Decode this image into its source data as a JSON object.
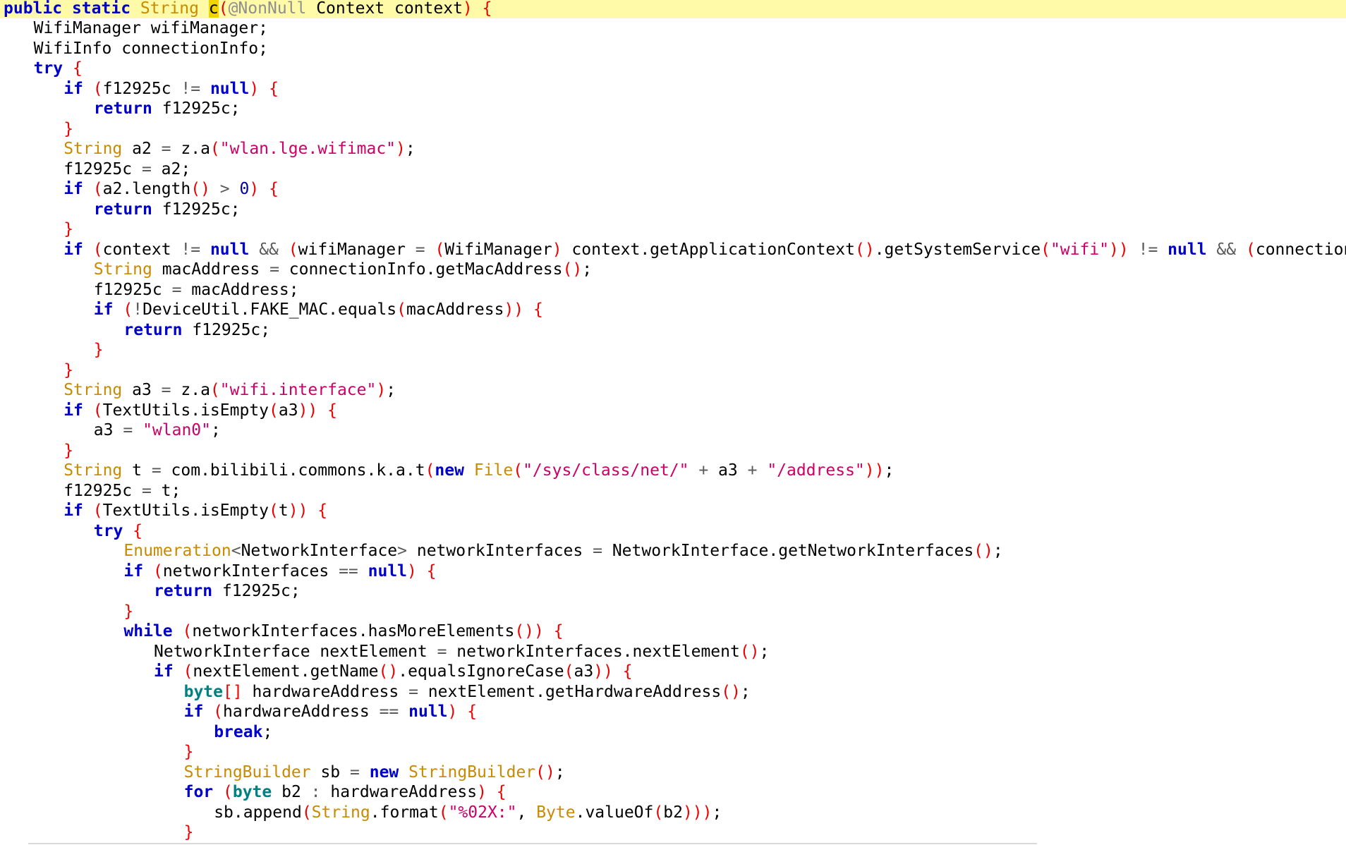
{
  "editor": {
    "language": "Java",
    "current_line": 0,
    "colors": {
      "keyword": "#0000cc",
      "type": "#c88a00",
      "primitive": "#008080",
      "string": "#cc0066",
      "number": "#0000aa",
      "bracket": "#ee0000",
      "annotation": "#8f8f8f",
      "operator": "#5a5a5a",
      "plain": "#000000",
      "current_line_bg": "#fffaa8",
      "symbol_highlight_bg": "#f0d400"
    },
    "lines": [
      {
        "indent": 0,
        "tokens": [
          [
            "kw",
            "public"
          ],
          [
            "pl",
            " "
          ],
          [
            "kw",
            "static"
          ],
          [
            "pl",
            " "
          ],
          [
            "ty",
            "String"
          ],
          [
            "pl",
            " "
          ],
          [
            "hl",
            "c"
          ],
          [
            "br",
            "("
          ],
          [
            "ann",
            "@NonNull"
          ],
          [
            "pl",
            " Context context"
          ],
          [
            "br",
            ")"
          ],
          [
            "pl",
            " "
          ],
          [
            "br",
            "{"
          ]
        ]
      },
      {
        "indent": 1,
        "tokens": [
          [
            "pl",
            "WifiManager wifiManager;"
          ]
        ]
      },
      {
        "indent": 1,
        "tokens": [
          [
            "pl",
            "WifiInfo connectionInfo;"
          ]
        ]
      },
      {
        "indent": 1,
        "tokens": [
          [
            "kw",
            "try"
          ],
          [
            "pl",
            " "
          ],
          [
            "br",
            "{"
          ]
        ]
      },
      {
        "indent": 2,
        "tokens": [
          [
            "kw",
            "if"
          ],
          [
            "pl",
            " "
          ],
          [
            "br",
            "("
          ],
          [
            "pl",
            "f12925c "
          ],
          [
            "op",
            "!="
          ],
          [
            "pl",
            " "
          ],
          [
            "kw",
            "null"
          ],
          [
            "br",
            ")"
          ],
          [
            "pl",
            " "
          ],
          [
            "br",
            "{"
          ]
        ]
      },
      {
        "indent": 3,
        "tokens": [
          [
            "kw",
            "return"
          ],
          [
            "pl",
            " f12925c;"
          ]
        ]
      },
      {
        "indent": 2,
        "tokens": [
          [
            "br",
            "}"
          ]
        ]
      },
      {
        "indent": 2,
        "tokens": [
          [
            "ty",
            "String"
          ],
          [
            "pl",
            " a2 "
          ],
          [
            "op",
            "="
          ],
          [
            "pl",
            " z.a"
          ],
          [
            "br",
            "("
          ],
          [
            "str",
            "\"wlan.lge.wifimac\""
          ],
          [
            "br",
            ")"
          ],
          [
            "pl",
            ";"
          ]
        ]
      },
      {
        "indent": 2,
        "tokens": [
          [
            "pl",
            "f12925c "
          ],
          [
            "op",
            "="
          ],
          [
            "pl",
            " a2;"
          ]
        ]
      },
      {
        "indent": 2,
        "tokens": [
          [
            "kw",
            "if"
          ],
          [
            "pl",
            " "
          ],
          [
            "br",
            "("
          ],
          [
            "pl",
            "a2.length"
          ],
          [
            "br",
            "()"
          ],
          [
            "pl",
            " "
          ],
          [
            "op",
            ">"
          ],
          [
            "pl",
            " "
          ],
          [
            "num",
            "0"
          ],
          [
            "br",
            ")"
          ],
          [
            "pl",
            " "
          ],
          [
            "br",
            "{"
          ]
        ]
      },
      {
        "indent": 3,
        "tokens": [
          [
            "kw",
            "return"
          ],
          [
            "pl",
            " f12925c;"
          ]
        ]
      },
      {
        "indent": 2,
        "tokens": [
          [
            "br",
            "}"
          ]
        ]
      },
      {
        "indent": 2,
        "tokens": [
          [
            "kw",
            "if"
          ],
          [
            "pl",
            " "
          ],
          [
            "br",
            "("
          ],
          [
            "pl",
            "context "
          ],
          [
            "op",
            "!="
          ],
          [
            "pl",
            " "
          ],
          [
            "kw",
            "null"
          ],
          [
            "pl",
            " "
          ],
          [
            "op",
            "&&"
          ],
          [
            "pl",
            " "
          ],
          [
            "br",
            "("
          ],
          [
            "pl",
            "wifiManager "
          ],
          [
            "op",
            "="
          ],
          [
            "pl",
            " "
          ],
          [
            "br",
            "("
          ],
          [
            "pl",
            "WifiManager"
          ],
          [
            "br",
            ")"
          ],
          [
            "pl",
            " context.getApplicationContext"
          ],
          [
            "br",
            "()"
          ],
          [
            "pl",
            ".getSystemService"
          ],
          [
            "br",
            "("
          ],
          [
            "str",
            "\"wifi\""
          ],
          [
            "br",
            "))"
          ],
          [
            "pl",
            " "
          ],
          [
            "op",
            "!="
          ],
          [
            "pl",
            " "
          ],
          [
            "kw",
            "null"
          ],
          [
            "pl",
            " "
          ],
          [
            "op",
            "&&"
          ],
          [
            "pl",
            " "
          ],
          [
            "br",
            "("
          ],
          [
            "pl",
            "connectionInfo "
          ],
          [
            "op",
            "="
          ]
        ]
      },
      {
        "indent": 3,
        "tokens": [
          [
            "ty",
            "String"
          ],
          [
            "pl",
            " macAddress "
          ],
          [
            "op",
            "="
          ],
          [
            "pl",
            " connectionInfo.getMacAddress"
          ],
          [
            "br",
            "()"
          ],
          [
            "pl",
            ";"
          ]
        ]
      },
      {
        "indent": 3,
        "tokens": [
          [
            "pl",
            "f12925c "
          ],
          [
            "op",
            "="
          ],
          [
            "pl",
            " macAddress;"
          ]
        ]
      },
      {
        "indent": 3,
        "tokens": [
          [
            "kw",
            "if"
          ],
          [
            "pl",
            " "
          ],
          [
            "br",
            "("
          ],
          [
            "op",
            "!"
          ],
          [
            "pl",
            "DeviceUtil.FAKE_MAC.equals"
          ],
          [
            "br",
            "("
          ],
          [
            "pl",
            "macAddress"
          ],
          [
            "br",
            "))"
          ],
          [
            "pl",
            " "
          ],
          [
            "br",
            "{"
          ]
        ]
      },
      {
        "indent": 4,
        "tokens": [
          [
            "kw",
            "return"
          ],
          [
            "pl",
            " f12925c;"
          ]
        ]
      },
      {
        "indent": 3,
        "tokens": [
          [
            "br",
            "}"
          ]
        ]
      },
      {
        "indent": 2,
        "tokens": [
          [
            "br",
            "}"
          ]
        ]
      },
      {
        "indent": 2,
        "tokens": [
          [
            "ty",
            "String"
          ],
          [
            "pl",
            " a3 "
          ],
          [
            "op",
            "="
          ],
          [
            "pl",
            " z.a"
          ],
          [
            "br",
            "("
          ],
          [
            "str",
            "\"wifi.interface\""
          ],
          [
            "br",
            ")"
          ],
          [
            "pl",
            ";"
          ]
        ]
      },
      {
        "indent": 2,
        "tokens": [
          [
            "kw",
            "if"
          ],
          [
            "pl",
            " "
          ],
          [
            "br",
            "("
          ],
          [
            "pl",
            "TextUtils.isEmpty"
          ],
          [
            "br",
            "("
          ],
          [
            "pl",
            "a3"
          ],
          [
            "br",
            "))"
          ],
          [
            "pl",
            " "
          ],
          [
            "br",
            "{"
          ]
        ]
      },
      {
        "indent": 3,
        "tokens": [
          [
            "pl",
            "a3 "
          ],
          [
            "op",
            "="
          ],
          [
            "pl",
            " "
          ],
          [
            "str",
            "\"wlan0\""
          ],
          [
            "pl",
            ";"
          ]
        ]
      },
      {
        "indent": 2,
        "tokens": [
          [
            "br",
            "}"
          ]
        ]
      },
      {
        "indent": 2,
        "tokens": [
          [
            "ty",
            "String"
          ],
          [
            "pl",
            " t "
          ],
          [
            "op",
            "="
          ],
          [
            "pl",
            " com.bilibili.commons.k.a.t"
          ],
          [
            "br",
            "("
          ],
          [
            "kw",
            "new"
          ],
          [
            "pl",
            " "
          ],
          [
            "ty",
            "File"
          ],
          [
            "br",
            "("
          ],
          [
            "str",
            "\"/sys/class/net/\""
          ],
          [
            "pl",
            " "
          ],
          [
            "op",
            "+"
          ],
          [
            "pl",
            " a3 "
          ],
          [
            "op",
            "+"
          ],
          [
            "pl",
            " "
          ],
          [
            "str",
            "\"/address\""
          ],
          [
            "br",
            "))"
          ],
          [
            "pl",
            ";"
          ]
        ]
      },
      {
        "indent": 2,
        "tokens": [
          [
            "pl",
            "f12925c "
          ],
          [
            "op",
            "="
          ],
          [
            "pl",
            " t;"
          ]
        ]
      },
      {
        "indent": 2,
        "tokens": [
          [
            "kw",
            "if"
          ],
          [
            "pl",
            " "
          ],
          [
            "br",
            "("
          ],
          [
            "pl",
            "TextUtils.isEmpty"
          ],
          [
            "br",
            "("
          ],
          [
            "pl",
            "t"
          ],
          [
            "br",
            "))"
          ],
          [
            "pl",
            " "
          ],
          [
            "br",
            "{"
          ]
        ]
      },
      {
        "indent": 3,
        "tokens": [
          [
            "kw",
            "try"
          ],
          [
            "pl",
            " "
          ],
          [
            "br",
            "{"
          ]
        ]
      },
      {
        "indent": 4,
        "tokens": [
          [
            "ty",
            "Enumeration"
          ],
          [
            "op",
            "<"
          ],
          [
            "pl",
            "NetworkInterface"
          ],
          [
            "op",
            ">"
          ],
          [
            "pl",
            " networkInterfaces "
          ],
          [
            "op",
            "="
          ],
          [
            "pl",
            " NetworkInterface.getNetworkInterfaces"
          ],
          [
            "br",
            "()"
          ],
          [
            "pl",
            ";"
          ]
        ]
      },
      {
        "indent": 4,
        "tokens": [
          [
            "kw",
            "if"
          ],
          [
            "pl",
            " "
          ],
          [
            "br",
            "("
          ],
          [
            "pl",
            "networkInterfaces "
          ],
          [
            "op",
            "=="
          ],
          [
            "pl",
            " "
          ],
          [
            "kw",
            "null"
          ],
          [
            "br",
            ")"
          ],
          [
            "pl",
            " "
          ],
          [
            "br",
            "{"
          ]
        ]
      },
      {
        "indent": 5,
        "tokens": [
          [
            "kw",
            "return"
          ],
          [
            "pl",
            " f12925c;"
          ]
        ]
      },
      {
        "indent": 4,
        "tokens": [
          [
            "br",
            "}"
          ]
        ]
      },
      {
        "indent": 4,
        "tokens": [
          [
            "kw",
            "while"
          ],
          [
            "pl",
            " "
          ],
          [
            "br",
            "("
          ],
          [
            "pl",
            "networkInterfaces.hasMoreElements"
          ],
          [
            "br",
            "())"
          ],
          [
            "pl",
            " "
          ],
          [
            "br",
            "{"
          ]
        ]
      },
      {
        "indent": 5,
        "tokens": [
          [
            "pl",
            "NetworkInterface nextElement "
          ],
          [
            "op",
            "="
          ],
          [
            "pl",
            " networkInterfaces.nextElement"
          ],
          [
            "br",
            "()"
          ],
          [
            "pl",
            ";"
          ]
        ]
      },
      {
        "indent": 5,
        "tokens": [
          [
            "kw",
            "if"
          ],
          [
            "pl",
            " "
          ],
          [
            "br",
            "("
          ],
          [
            "pl",
            "nextElement.getName"
          ],
          [
            "br",
            "()"
          ],
          [
            "pl",
            ".equalsIgnoreCase"
          ],
          [
            "br",
            "("
          ],
          [
            "pl",
            "a3"
          ],
          [
            "br",
            "))"
          ],
          [
            "pl",
            " "
          ],
          [
            "br",
            "{"
          ]
        ]
      },
      {
        "indent": 6,
        "tokens": [
          [
            "pt",
            "byte"
          ],
          [
            "br",
            "[]"
          ],
          [
            "pl",
            " hardwareAddress "
          ],
          [
            "op",
            "="
          ],
          [
            "pl",
            " nextElement.getHardwareAddress"
          ],
          [
            "br",
            "()"
          ],
          [
            "pl",
            ";"
          ]
        ]
      },
      {
        "indent": 6,
        "tokens": [
          [
            "kw",
            "if"
          ],
          [
            "pl",
            " "
          ],
          [
            "br",
            "("
          ],
          [
            "pl",
            "hardwareAddress "
          ],
          [
            "op",
            "=="
          ],
          [
            "pl",
            " "
          ],
          [
            "kw",
            "null"
          ],
          [
            "br",
            ")"
          ],
          [
            "pl",
            " "
          ],
          [
            "br",
            "{"
          ]
        ]
      },
      {
        "indent": 7,
        "tokens": [
          [
            "kw",
            "break"
          ],
          [
            "pl",
            ";"
          ]
        ]
      },
      {
        "indent": 6,
        "tokens": [
          [
            "br",
            "}"
          ]
        ]
      },
      {
        "indent": 6,
        "tokens": [
          [
            "ty",
            "StringBuilder"
          ],
          [
            "pl",
            " sb "
          ],
          [
            "op",
            "="
          ],
          [
            "pl",
            " "
          ],
          [
            "kw",
            "new"
          ],
          [
            "pl",
            " "
          ],
          [
            "ty",
            "StringBuilder"
          ],
          [
            "br",
            "()"
          ],
          [
            "pl",
            ";"
          ]
        ]
      },
      {
        "indent": 6,
        "tokens": [
          [
            "kw",
            "for"
          ],
          [
            "pl",
            " "
          ],
          [
            "br",
            "("
          ],
          [
            "pt",
            "byte"
          ],
          [
            "pl",
            " b2 "
          ],
          [
            "op",
            ":"
          ],
          [
            "pl",
            " hardwareAddress"
          ],
          [
            "br",
            ")"
          ],
          [
            "pl",
            " "
          ],
          [
            "br",
            "{"
          ]
        ]
      },
      {
        "indent": 7,
        "tokens": [
          [
            "pl",
            "sb.append"
          ],
          [
            "br",
            "("
          ],
          [
            "ty",
            "String"
          ],
          [
            "pl",
            ".format"
          ],
          [
            "br",
            "("
          ],
          [
            "str",
            "\"%02X:\""
          ],
          [
            "pl",
            ", "
          ],
          [
            "ty",
            "Byte"
          ],
          [
            "pl",
            ".valueOf"
          ],
          [
            "br",
            "("
          ],
          [
            "pl",
            "b2"
          ],
          [
            "br",
            ")))"
          ],
          [
            "pl",
            ";"
          ]
        ]
      },
      {
        "indent": 6,
        "tokens": [
          [
            "br",
            "}"
          ]
        ]
      }
    ]
  }
}
